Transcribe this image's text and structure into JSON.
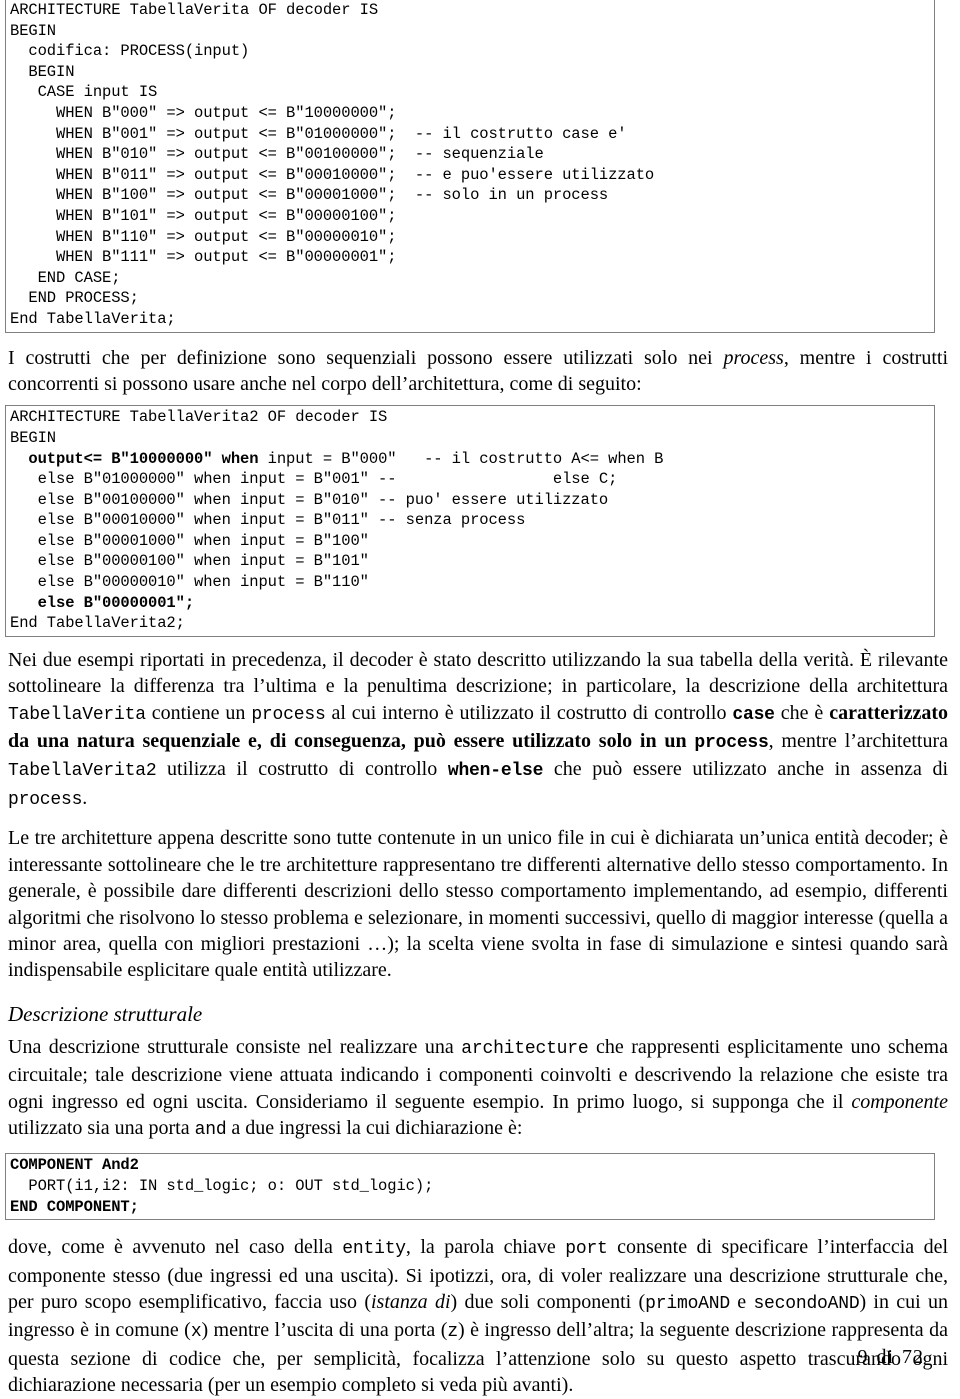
{
  "document": {
    "language": "it",
    "footer": {
      "page_number": "9",
      "separator": "di",
      "total_pages": "72"
    }
  },
  "code_block_1": {
    "name": "architecture-tabellaverita",
    "continued_from_previous_page": true,
    "lines": [
      "ARCHITECTURE TabellaVerita OF decoder IS",
      "BEGIN",
      "  codifica: PROCESS(input)",
      "  BEGIN",
      "   CASE input IS",
      "     WHEN B\"000\" => output <= B\"10000000\";",
      "     WHEN B\"001\" => output <= B\"01000000\";  -- il costrutto case e'",
      "     WHEN B\"010\" => output <= B\"00100000\";  -- sequenziale",
      "     WHEN B\"011\" => output <= B\"00010000\";  -- e puo'essere utilizzato",
      "     WHEN B\"100\" => output <= B\"00001000\";  -- solo in un process",
      "     WHEN B\"101\" => output <= B\"00000100\";",
      "     WHEN B\"110\" => output <= B\"00000010\";",
      "     WHEN B\"111\" => output <= B\"00000001\";",
      "   END CASE;",
      "  END PROCESS;",
      "End TabellaVerita;"
    ]
  },
  "paragraph_1": {
    "segments": [
      {
        "text": "I costrutti che per definizione sono sequenziali possono essere utilizzati solo nei ",
        "style": "normal"
      },
      {
        "text": "process",
        "style": "italic"
      },
      {
        "text": ", mentre i costrutti concorrenti si possono usare anche nel corpo dell’architettura, come di seguito:",
        "style": "normal"
      }
    ]
  },
  "code_block_2": {
    "name": "architecture-tabellaverita2",
    "lines": [
      {
        "text": "ARCHITECTURE TabellaVerita2 OF decoder IS",
        "bold_prefix": ""
      },
      {
        "text": "BEGIN",
        "bold_prefix": ""
      },
      {
        "bold": "  output<= B\"10000000\" when",
        "rest": " input = B\"000\"   -- il costrutto A<= when B"
      },
      {
        "bold": "",
        "rest": "   else B\"01000000\" when input = B\"001\" --                 else C;"
      },
      {
        "bold": "",
        "rest": "   else B\"00100000\" when input = B\"010\" -- puo' essere utilizzato"
      },
      {
        "bold": "",
        "rest": "   else B\"00010000\" when input = B\"011\" -- senza process"
      },
      {
        "bold": "",
        "rest": "   else B\"00001000\" when input = B\"100\""
      },
      {
        "bold": "",
        "rest": "   else B\"00000100\" when input = B\"101\""
      },
      {
        "bold": "",
        "rest": "   else B\"00000010\" when input = B\"110\""
      },
      {
        "bold": "   else B\"00000001\";",
        "rest": ""
      },
      {
        "bold": "",
        "rest": "End TabellaVerita2;"
      }
    ]
  },
  "paragraph_2": {
    "segments": [
      {
        "text": "Nei due esempi riportati in precedenza, il decoder è stato descritto utilizzando la sua tabella della verità. È rilevante sottolineare la differenza tra l’ultima e la penultima descrizione; in particolare, la descrizione della architettura ",
        "style": "normal"
      },
      {
        "text": "TabellaVerita",
        "style": "mono"
      },
      {
        "text": " contiene un ",
        "style": "normal"
      },
      {
        "text": "process",
        "style": "mono"
      },
      {
        "text": " al cui interno è utilizzato il costrutto di controllo ",
        "style": "normal"
      },
      {
        "text": "case",
        "style": "mono-bold"
      },
      {
        "text": " che è ",
        "style": "normal"
      },
      {
        "text": "caratterizzato da una natura sequenziale e, di conseguenza, può essere utilizzato solo in un ",
        "style": "bold"
      },
      {
        "text": "process",
        "style": "mono-bold"
      },
      {
        "text": ", mentre l’architettura ",
        "style": "normal"
      },
      {
        "text": "TabellaVerita2",
        "style": "mono"
      },
      {
        "text": " utilizza il costrutto di controllo ",
        "style": "normal"
      },
      {
        "text": "when-else",
        "style": "mono-bold"
      },
      {
        "text": " che può essere utilizzato anche in assenza di ",
        "style": "normal"
      },
      {
        "text": "process",
        "style": "mono"
      },
      {
        "text": ".",
        "style": "normal"
      }
    ]
  },
  "paragraph_3": {
    "segments": [
      {
        "text": "Le tre architetture appena descritte sono tutte contenute in un unico file in cui è dichiarata un’unica entità decoder; è interessante sottolineare che le tre architetture rappresentano tre differenti alternative dello stesso comportamento. In generale, è possibile dare differenti descrizioni dello stesso comportamento implementando, ad esempio, differenti algoritmi che risolvono lo stesso problema e selezionare, in momenti successivi, quello di maggior interesse (quella a minor area, quella con migliori prestazioni …); la scelta viene svolta in fase di simulazione e sintesi quando sarà indispensabile esplicitare quale entità utilizzare.",
        "style": "normal"
      }
    ]
  },
  "heading_1": {
    "text": "Descrizione strutturale"
  },
  "paragraph_4": {
    "segments": [
      {
        "text": "Una descrizione strutturale consiste nel realizzare una ",
        "style": "normal"
      },
      {
        "text": "architecture",
        "style": "mono"
      },
      {
        "text": " che rappresenti esplicitamente uno schema circuitale; tale descrizione viene attuata indicando i componenti coinvolti e descrivendo la relazione che esiste tra ogni ingresso ed ogni uscita. Consideriamo il seguente esempio. In primo luogo, si supponga che il ",
        "style": "normal"
      },
      {
        "text": "componente",
        "style": "italic"
      },
      {
        "text": " utilizzato sia una porta ",
        "style": "normal"
      },
      {
        "text": "and",
        "style": "mono"
      },
      {
        "text": " a due ingressi la cui dichiarazione è:",
        "style": "normal"
      }
    ]
  },
  "code_block_3": {
    "name": "component-and2",
    "lines": [
      {
        "bold": "COMPONENT And2",
        "rest": ""
      },
      {
        "bold": "",
        "rest": "  PORT(i1,i2: IN std_logic; o: OUT std_logic);"
      },
      {
        "bold": "END COMPONENT;",
        "rest": ""
      }
    ]
  },
  "paragraph_5": {
    "segments": [
      {
        "text": "dove, come è avvenuto nel caso della ",
        "style": "normal"
      },
      {
        "text": "entity",
        "style": "mono"
      },
      {
        "text": ", la parola chiave ",
        "style": "normal"
      },
      {
        "text": "port",
        "style": "mono"
      },
      {
        "text": " consente di specificare l’interfaccia del componente stesso (due ingressi ed una uscita). Si ipotizzi, ora, di voler realizzare una descrizione strutturale che, per puro scopo esemplificativo, faccia uso (",
        "style": "normal"
      },
      {
        "text": "istanza di",
        "style": "italic"
      },
      {
        "text": ") due soli componenti (",
        "style": "normal"
      },
      {
        "text": "primoAND",
        "style": "mono"
      },
      {
        "text": " e ",
        "style": "normal"
      },
      {
        "text": "secondoAND",
        "style": "mono"
      },
      {
        "text": ") in cui un ingresso è in comune (",
        "style": "normal"
      },
      {
        "text": "x",
        "style": "mono"
      },
      {
        "text": ") mentre l’uscita di una porta (",
        "style": "normal"
      },
      {
        "text": "z",
        "style": "mono"
      },
      {
        "text": ") è ingresso dell’altra; la seguente descrizione rappresenta da questa sezione di codice che, per semplicità, focalizza l’attenzione solo su questo aspetto trascurando ogni dichiarazione necessaria (per un esempio completo si veda più avanti).",
        "style": "normal"
      }
    ]
  }
}
